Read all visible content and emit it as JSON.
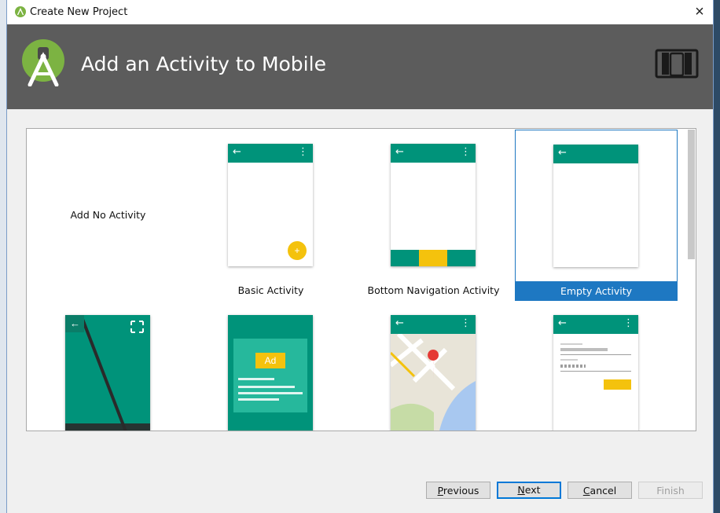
{
  "window": {
    "title": "Create New Project",
    "close_label": "×"
  },
  "header": {
    "title": "Add an Activity to Mobile"
  },
  "templates": [
    {
      "label": "Add No Activity"
    },
    {
      "label": "Basic Activity"
    },
    {
      "label": "Bottom Navigation Activity"
    },
    {
      "label": "Empty Activity",
      "selected": true
    },
    {
      "label": ""
    },
    {
      "label": "",
      "ad_text": "Ad"
    },
    {
      "label": ""
    },
    {
      "label": ""
    }
  ],
  "buttons": {
    "previous": {
      "mnemonic": "P",
      "rest": "revious"
    },
    "next": {
      "mnemonic": "N",
      "rest": "ext"
    },
    "cancel": {
      "mnemonic": "C",
      "rest": "ancel"
    },
    "finish": "Finish"
  },
  "phone_glyphs": {
    "back": "←",
    "menu": "⋮",
    "fab": "+"
  },
  "colors": {
    "header_bg": "#5c5c5c",
    "appbar": "#00937a",
    "accent": "#f4c20d",
    "selection": "#1e78c2"
  }
}
